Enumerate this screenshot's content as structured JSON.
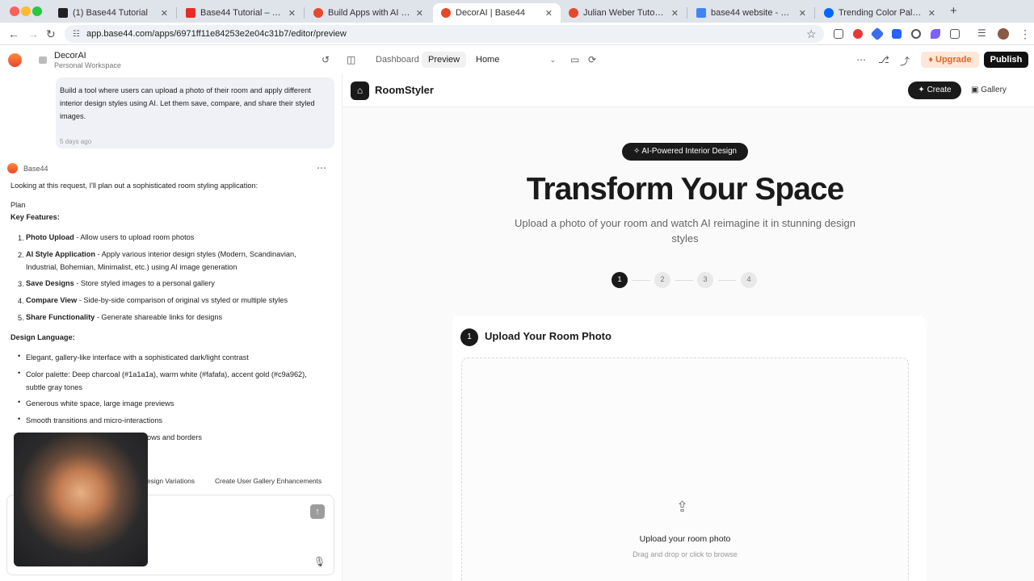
{
  "browser": {
    "tabs": [
      {
        "label": "(1) Base44 Tutorial",
        "favicon_color": "#222222"
      },
      {
        "label": "Base44 Tutorial – How to build",
        "favicon_color": "#e52d27"
      },
      {
        "label": "Build Apps with AI in Minutes",
        "favicon_color": "#e8472b"
      },
      {
        "label": "DecorAI | Base44",
        "favicon_color": "#e8472b",
        "active": true
      },
      {
        "label": "Julian Weber Tutorials | Base44",
        "favicon_color": "#e8472b"
      },
      {
        "label": "base44 website - Google Docs",
        "favicon_color": "#4285f4"
      },
      {
        "label": "Trending Color Palettes - Coolors",
        "favicon_color": "#0066ff"
      }
    ],
    "new_tab": "+",
    "url": "app.base44.com/apps/6971ff11e84253e2e04c31b7/editor/preview"
  },
  "app_header": {
    "workspace_name": "DecorAI",
    "workspace_sub": "Personal Workspace",
    "tabs": {
      "dashboard": "Dashboard",
      "preview": "Preview"
    },
    "page_select": "Home",
    "upgrade": "Upgrade",
    "publish": "Publish"
  },
  "chat": {
    "user_message": "Build a tool where users can upload a photo of their room and apply different interior design styles using AI. Let them save, compare, and share their styled images.",
    "user_time": "5 days ago",
    "bot_name": "Base44",
    "intro": "Looking at this request, I'll plan out a sophisticated room styling application:",
    "plan": "Plan",
    "key_features_heading": "Key Features:",
    "features": [
      {
        "n": "1.",
        "title": "Photo Upload",
        "text": " - Allow users to upload room photos"
      },
      {
        "n": "2.",
        "title": "AI Style Application",
        "text": " - Apply various interior design styles (Modern, Scandinavian,",
        "text2": "Industrial, Bohemian, Minimalist, etc.) using AI image generation"
      },
      {
        "n": "3.",
        "title": "Save Designs",
        "text": " - Store styled images to a personal gallery"
      },
      {
        "n": "4.",
        "title": "Compare View",
        "text": " - Side-by-side comparison of original vs styled or multiple styles"
      },
      {
        "n": "5.",
        "title": "Share Functionality",
        "text": " - Generate shareable links for designs"
      }
    ],
    "design_heading": "Design Language:",
    "design_items": [
      "Elegant, gallery-like interface with a sophisticated dark/light contrast",
      "Color palette: Deep charcoal (#1a1a1a), warm white (#fafafa), accent gold (#c9a962),",
      "subtle gray tones",
      "Generous white space, large image previews",
      "Smooth transitions and micro-interactions",
      "ows and borders"
    ],
    "suggestions": [
      "esign Variations",
      "Create User Gallery Enhancements"
    ]
  },
  "preview": {
    "brand": "RoomStyler",
    "create": "Create",
    "gallery": "Gallery",
    "badge": "AI-Powered Interior Design",
    "hero": "Transform Your Space",
    "subtitle": "Upload a photo of your room and watch AI reimagine it in stunning design styles",
    "steps": [
      "1",
      "2",
      "3",
      "4"
    ],
    "current_step": 1,
    "card_num": "1",
    "card_title": "Upload Your Room Photo",
    "upload_title": "Upload your room photo",
    "upload_sub": "Drag and drop or click to browse"
  },
  "colors": {
    "charcoal": "#1a1a1a",
    "brand_orange": "#e8472b",
    "upgrade_text": "#e0682a"
  }
}
